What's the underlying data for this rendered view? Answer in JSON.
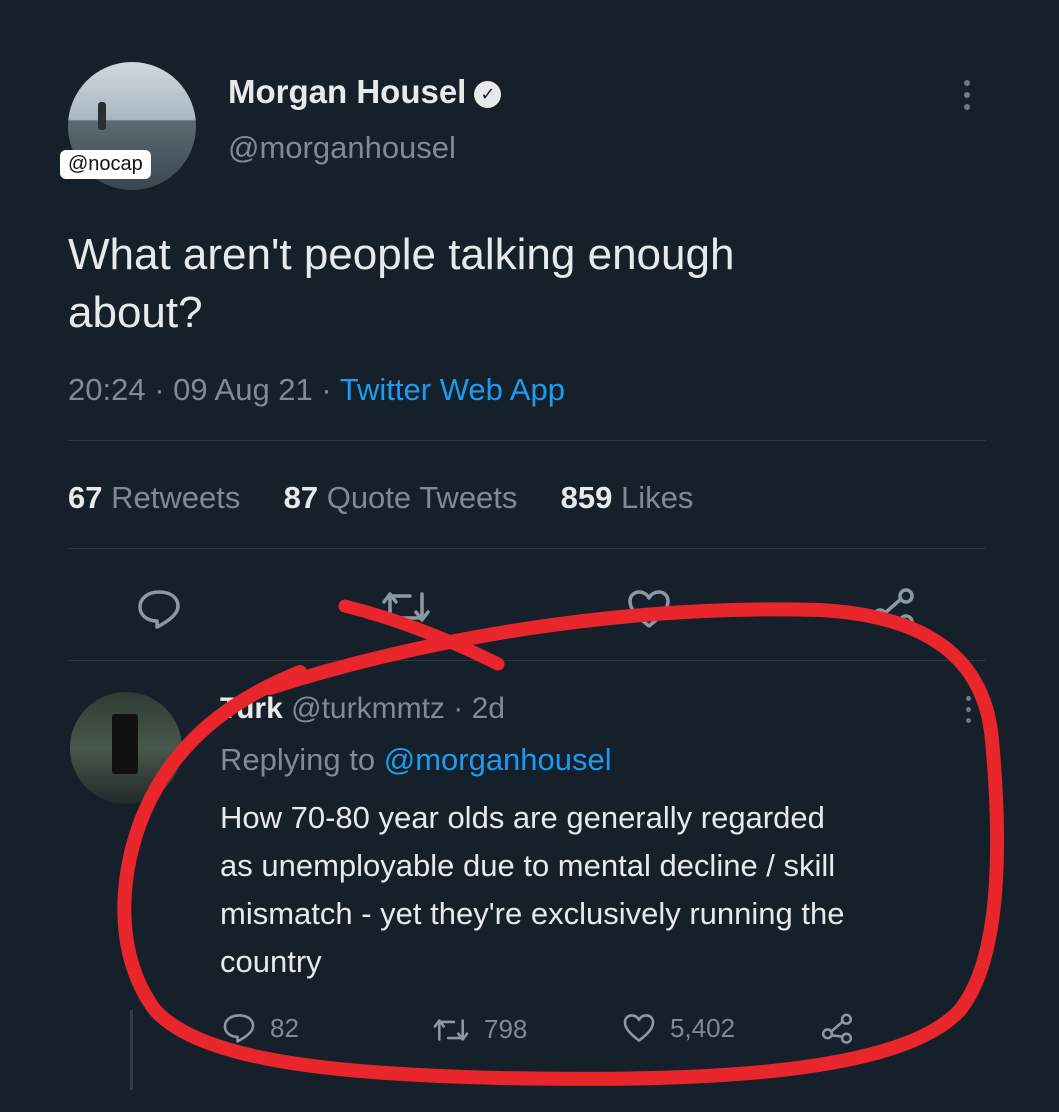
{
  "watermark": "@nocap",
  "tweet": {
    "author_name": "Morgan Housel",
    "author_handle": "@morganhousel",
    "text_line1": "What aren't people talking enough",
    "text_line2": "about?",
    "time": "20:24",
    "date": "09 Aug 21",
    "source": "Twitter Web App",
    "stats": {
      "retweets_count": "67",
      "retweets_label": "Retweets",
      "quotes_count": "87",
      "quotes_label": "Quote Tweets",
      "likes_count": "859",
      "likes_label": "Likes"
    },
    "icons": [
      "reply-icon",
      "retweet-icon",
      "like-icon",
      "share-icon",
      "more-icon"
    ]
  },
  "reply": {
    "author_name": "Turk",
    "author_handle": "@turkmmtz",
    "age": "2d",
    "replying_to_label": "Replying to",
    "replying_to_handle": "@morganhousel",
    "text_lines": [
      "How 70-80 year olds are generally regarded",
      "as unemployable due to mental decline / skill",
      "mismatch - yet they're exclusively running the",
      "country"
    ],
    "reply_count": "82",
    "retweet_count": "798",
    "like_count": "5,402"
  },
  "colors": {
    "background": "#15202b",
    "accent_blue": "#1d9bf0",
    "annotation_red": "#e8262b"
  }
}
